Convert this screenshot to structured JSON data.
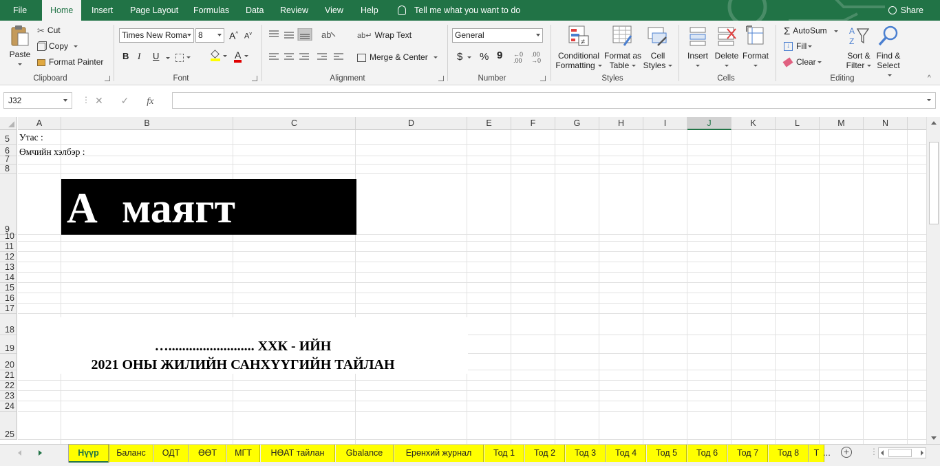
{
  "ribbon_tabs": {
    "file": "File",
    "home": "Home",
    "insert": "Insert",
    "page_layout": "Page Layout",
    "formulas": "Formulas",
    "data": "Data",
    "review": "Review",
    "view": "View",
    "help": "Help",
    "tell_me": "Tell me what you want to do",
    "share": "Share"
  },
  "clipboard": {
    "paste": "Paste",
    "cut": "Cut",
    "copy": "Copy",
    "format_painter": "Format Painter",
    "label": "Clipboard"
  },
  "font": {
    "name": "Times New Roma",
    "size": "8",
    "bold": "B",
    "italic": "I",
    "underline": "U",
    "label": "Font",
    "grow": "A",
    "shrink": "A",
    "color_letter": "A"
  },
  "alignment": {
    "wrap_text": "Wrap Text",
    "merge_center": "Merge & Center",
    "label": "Alignment"
  },
  "number": {
    "format": "General",
    "currency": "$",
    "percent": "%",
    "comma": "9",
    "label": "Number"
  },
  "styles": {
    "conditional_1": "Conditional",
    "conditional_2": "Formatting",
    "format_table_1": "Format as",
    "format_table_2": "Table",
    "cell_styles_1": "Cell",
    "cell_styles_2": "Styles",
    "label": "Styles"
  },
  "cells": {
    "insert": "Insert",
    "delete": "Delete",
    "format": "Format",
    "label": "Cells"
  },
  "editing": {
    "autosum": "AutoSum",
    "fill": "Fill",
    "clear": "Clear",
    "sort_1": "Sort &",
    "sort_2": "Filter",
    "find_1": "Find &",
    "find_2": "Select",
    "label": "Editing"
  },
  "formula_bar": {
    "name_box": "J32",
    "fx": "fx",
    "cancel": "✕",
    "enter": "✓",
    "content": ""
  },
  "columns": [
    "A",
    "B",
    "C",
    "D",
    "E",
    "F",
    "G",
    "H",
    "I",
    "J",
    "K",
    "L",
    "M",
    "N"
  ],
  "selected_column": "J",
  "rows": [
    "5",
    "6",
    "7",
    "8",
    "9",
    "10",
    "11",
    "12",
    "13",
    "14",
    "15",
    "16",
    "17",
    "18",
    "19",
    "20",
    "21",
    "22",
    "23",
    "24",
    "25"
  ],
  "cells_content": {
    "a5": "Утас :",
    "a6": "Өмчийн хэлбэр :",
    "banner_letter": "А",
    "banner_word": "маягт",
    "title_line1": "…......................... ХХК - ИЙН",
    "title_line2": "2021 ОНЫ ЖИЛИЙН САНХҮҮГИЙН ТАЙЛАН"
  },
  "sheet_tabs": [
    "Нүүр",
    "Баланс",
    "ОДТ",
    "ӨӨТ",
    "МГТ",
    "НӨАТ тайлан",
    "Gbalance",
    "Ерөнхий журнал",
    "Тод 1",
    "Тод 2",
    "Тод 3",
    "Тод 4",
    "Тод 5",
    "Тод 6",
    "Тод 7",
    "Тод 8",
    "Т"
  ],
  "active_sheet": "Нүүр",
  "more_tabs": "...",
  "colors": {
    "accent": "#217346",
    "tab_yellow": "#ffff00",
    "banner": "#000000"
  }
}
